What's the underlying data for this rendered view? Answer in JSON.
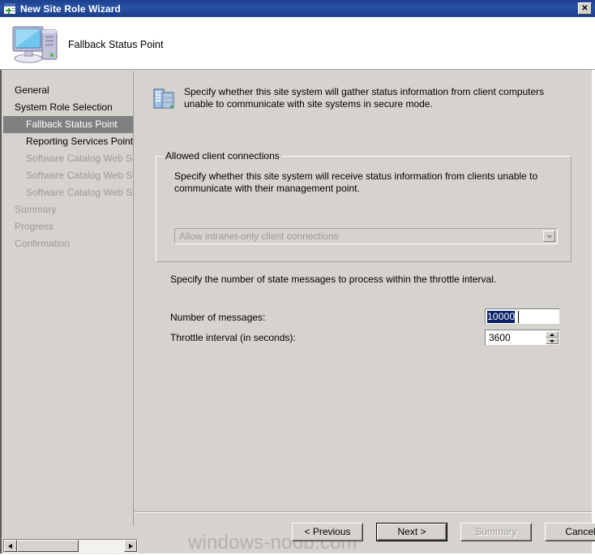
{
  "window": {
    "title": "New Site Role Wizard",
    "titlebar_icon": "new-window-icon",
    "close_label": "✕",
    "titlebar_color": "#1f3f8f"
  },
  "header": {
    "title": "Fallback Status Point",
    "icon": "computer-monitor-icon"
  },
  "sidebar": {
    "items": [
      {
        "label": "General",
        "level": 0,
        "state": "normal"
      },
      {
        "label": "System Role Selection",
        "level": 0,
        "state": "normal"
      },
      {
        "label": "Fallback Status Point",
        "level": 1,
        "state": "selected"
      },
      {
        "label": "Reporting Services Point",
        "level": 1,
        "state": "normal"
      },
      {
        "label": "Software Catalog Web Ser",
        "level": 1,
        "state": "disabled"
      },
      {
        "label": "Software Catalog Web Ser",
        "level": 1,
        "state": "disabled"
      },
      {
        "label": "Software Catalog Web Site",
        "level": 1,
        "state": "disabled"
      },
      {
        "label": "Summary",
        "level": 0,
        "state": "disabled"
      },
      {
        "label": "Progress",
        "level": 0,
        "state": "disabled"
      },
      {
        "label": "Confirmation",
        "level": 0,
        "state": "disabled"
      }
    ]
  },
  "main": {
    "intro_icon": "server-building-icon",
    "intro_text": "Specify whether this site system will gather status information from client computers unable to communicate with site systems in secure mode.",
    "groupbox": {
      "legend": "Allowed client connections",
      "description": "Specify whether this site system will receive status information from clients unable to communicate with their management point.",
      "combo": {
        "selected": "Allow intranet-only client connections",
        "disabled": true,
        "icon": "chevron-down-icon"
      }
    },
    "throttle_description": "Specify the number of state messages to process within the  throttle interval.",
    "fields": [
      {
        "label": "Number of messages:",
        "value": "10000",
        "selected": true
      },
      {
        "label": "Throttle interval (in seconds):",
        "value": "3600",
        "selected": false
      }
    ]
  },
  "footer": {
    "buttons": [
      {
        "label": "< Previous",
        "state": "normal"
      },
      {
        "label": "Next >",
        "state": "default"
      },
      {
        "label": "Summary",
        "state": "disabled"
      },
      {
        "label": "Cancel",
        "state": "normal"
      }
    ]
  },
  "watermark": {
    "text": "windows-noob.com"
  },
  "scrollbar": {
    "left_arrow": "arrow-left-icon",
    "right_arrow": "arrow-right-icon"
  }
}
